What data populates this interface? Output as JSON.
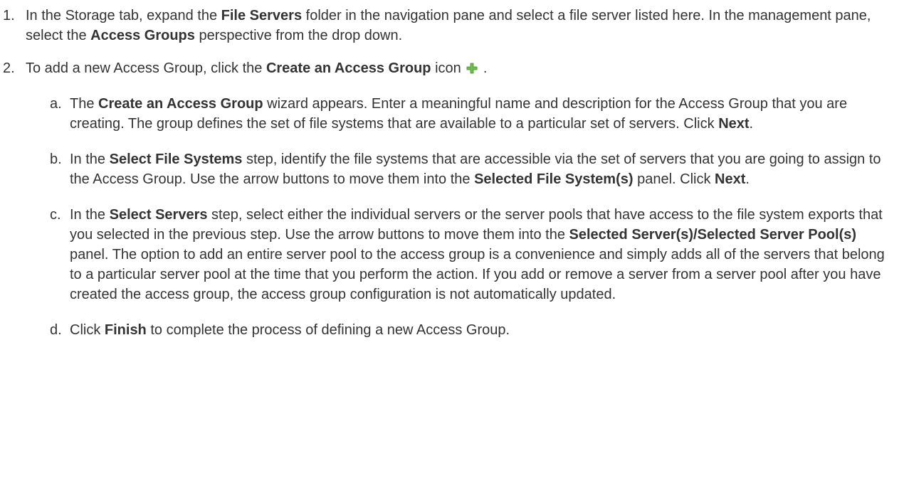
{
  "steps": [
    {
      "num": "1.",
      "parts": [
        {
          "t": "In the Storage tab, expand the "
        },
        {
          "t": "File Servers",
          "b": true
        },
        {
          "t": " folder in the navigation pane and select a file server listed here. In the management pane, select the "
        },
        {
          "t": "Access Groups",
          "b": true
        },
        {
          "t": " perspective from the drop down."
        }
      ]
    },
    {
      "num": "2.",
      "parts": [
        {
          "t": "To add a new Access Group, click the "
        },
        {
          "t": "Create an Access Group",
          "b": true
        },
        {
          "t": " icon "
        },
        {
          "icon": "plus-icon"
        },
        {
          "t": " ."
        }
      ],
      "substeps": [
        {
          "letter": "a.",
          "parts": [
            {
              "t": "The "
            },
            {
              "t": "Create an Access Group",
              "b": true
            },
            {
              "t": " wizard appears. Enter a meaningful name and description for the Access Group that you are creating. The group defines the set of file systems that are available to a particular set of servers. Click "
            },
            {
              "t": "Next",
              "b": true
            },
            {
              "t": "."
            }
          ]
        },
        {
          "letter": "b.",
          "parts": [
            {
              "t": "In the "
            },
            {
              "t": "Select File Systems",
              "b": true
            },
            {
              "t": " step, identify the file systems that are accessible via the set of servers that you are going to assign to the Access Group. Use the arrow buttons to move them into the "
            },
            {
              "t": "Selected File System(s)",
              "b": true
            },
            {
              "t": " panel. Click "
            },
            {
              "t": "Next",
              "b": true
            },
            {
              "t": "."
            }
          ]
        },
        {
          "letter": "c.",
          "parts": [
            {
              "t": "In the "
            },
            {
              "t": "Select Servers",
              "b": true
            },
            {
              "t": " step, select either the individual servers or the server pools that have access to the file system exports that you selected in the previous step. Use the arrow buttons to move them into the "
            },
            {
              "t": "Selected Server(s)/Selected Server Pool(s)",
              "b": true
            },
            {
              "t": " panel. The option to add an entire server pool to the access group is a convenience and simply adds all of the servers that belong to a particular server pool at the time that you perform the action. If you add or remove a server from a server pool after you have created the access group, the access group configuration is not automatically updated."
            }
          ]
        },
        {
          "letter": "d.",
          "parts": [
            {
              "t": "Click "
            },
            {
              "t": "Finish",
              "b": true
            },
            {
              "t": " to complete the process of defining a new Access Group."
            }
          ]
        }
      ]
    }
  ],
  "colors": {
    "text": "#333333",
    "plus_icon": "#6cc04a",
    "plus_icon_dark": "#3f8f2a"
  }
}
